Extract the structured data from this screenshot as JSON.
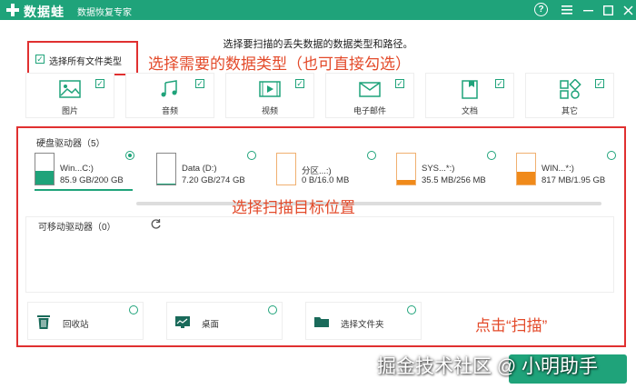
{
  "app": {
    "brand": "数据蛙",
    "product": "数据恢复专家",
    "help_icon": "?"
  },
  "colors": {
    "accent": "#1fa37a",
    "annotation": "#e34a2a",
    "highlight_border": "#e03030",
    "drive_orange": "#f08a1a"
  },
  "instruction": "选择要扫描的丢失数据的数据类型和路径。",
  "select_all": {
    "label": "选择所有文件类型",
    "checked": true
  },
  "file_types": [
    {
      "label": "图片",
      "icon": "picture-icon",
      "checked": true
    },
    {
      "label": "音频",
      "icon": "audio-icon",
      "checked": true
    },
    {
      "label": "视频",
      "icon": "video-icon",
      "checked": true
    },
    {
      "label": "电子邮件",
      "icon": "email-icon",
      "checked": true
    },
    {
      "label": "文档",
      "icon": "document-icon",
      "checked": true
    },
    {
      "label": "其它",
      "icon": "other-icon",
      "checked": true
    }
  ],
  "hard_drives": {
    "label": "硬盘驱动器（5）",
    "items": [
      {
        "name": "Win...C:)",
        "size": "85.9 GB/200 GB",
        "used": 0.43,
        "color": "#1fa37a",
        "selected": true
      },
      {
        "name": "Data (D:)",
        "size": "7.20 GB/274 GB",
        "used": 0.03,
        "color": "#1fa37a",
        "selected": false
      },
      {
        "name": "分区...:)",
        "size": "0 B/16.0 MB",
        "used": 0.0,
        "color": "#f08a1a",
        "selected": false
      },
      {
        "name": "SYS...*:)",
        "size": "35.5 MB/256 MB",
        "used": 0.14,
        "color": "#f08a1a",
        "selected": false
      },
      {
        "name": "WIN...*:)",
        "size": "817 MB/1.95 GB",
        "used": 0.42,
        "color": "#f08a1a",
        "selected": false
      }
    ]
  },
  "removable": {
    "label": "可移动驱动器（0）"
  },
  "quick_locations": [
    {
      "label": "回收站",
      "icon": "recycle-bin-icon"
    },
    {
      "label": "桌面",
      "icon": "desktop-icon"
    },
    {
      "label": "选择文件夹",
      "icon": "folder-icon"
    }
  ],
  "annotations": {
    "types": "选择需要的数据类型（也可直接勾选）",
    "location": "选择扫描目标位置",
    "scan": "点击“扫描”"
  },
  "watermark": "掘金技术社区 @ 小明助手"
}
